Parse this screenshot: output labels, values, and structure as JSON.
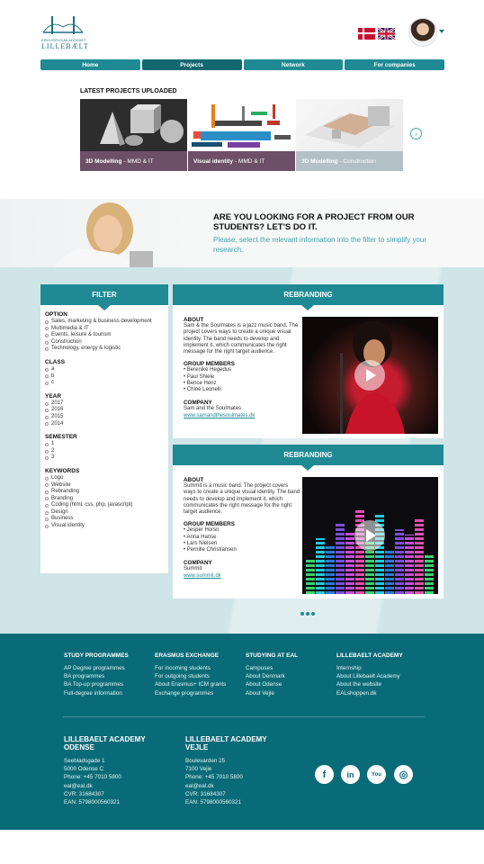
{
  "header": {
    "logo_line1": "ERHVERVSAKADEMIET",
    "logo_line2": "LILLEBÆLT"
  },
  "nav": {
    "items": [
      {
        "label": "Home"
      },
      {
        "label": "Projects"
      },
      {
        "label": "Network"
      },
      {
        "label": "For companies"
      }
    ],
    "active_index": 1
  },
  "latest": {
    "title": "LATEST PROJECTS UPLOADED",
    "cards": [
      {
        "category": "3D Modelling",
        "tag": "- MMD & IT"
      },
      {
        "category": "Visual identity",
        "tag": "- MMD & IT"
      },
      {
        "category": "3D Modelling",
        "tag": "- Construction"
      }
    ]
  },
  "hero": {
    "title": "ARE YOU LOOKING FOR A PROJECT FROM OUR STUDENTS? LET'S DO IT.",
    "subtitle": "Please, select the relevant information into the filter to simplify your research."
  },
  "filter": {
    "title": "FILTER",
    "groups": [
      {
        "title": "OPTION",
        "options": [
          "Sales, marketing & business development",
          "Multimedia & IT",
          "Events, leisure & tourism",
          "Construction",
          "Technology, energy & logistic"
        ]
      },
      {
        "title": "CLASS",
        "options": [
          "a",
          "b",
          "c"
        ]
      },
      {
        "title": "YEAR",
        "options": [
          "2017",
          "2016",
          "2015",
          "2014"
        ]
      },
      {
        "title": "SEMESTER",
        "options": [
          "1",
          "2",
          "3"
        ]
      },
      {
        "title": "KEYWORDS",
        "options": [
          "Logo",
          "Website",
          "Rebranding",
          "Branding",
          "Coding (html, css, php, javascript)",
          "Design",
          "Business",
          "Visual identity"
        ]
      }
    ]
  },
  "projects": [
    {
      "title": "REBRANDING",
      "about_label": "ABOUT",
      "about": "Sam & the Soulmates is a jazz music band. The project covers ways to create a unique visual identity. The band needs to develop and implement it, which communicates the right message for the right target audience.",
      "members_label": "GROUP MEMBERS",
      "members": [
        "Bereniké Hegedus",
        "Paul Shiele",
        "Bence Henz",
        "Chloé Leonelli"
      ],
      "company_label": "COMPANY",
      "company": "Sam and the Soulmates",
      "link": "www.samandthesoulmates.dk"
    },
    {
      "title": "REBRANDING",
      "about_label": "ABOUT",
      "about": "Summit is a music band. The project covers ways to create a unique visual identity. The band needs to develop and implement it, which communicates the right message for the right target audience.",
      "members_label": "GROUP MEMBERS",
      "members": [
        "Jesper Horsn",
        "Anna Hanse",
        "Lars Nielsen",
        "Pernille Christiansen"
      ],
      "company_label": "COMPANY",
      "company": "Summit",
      "link": "www.summit.dk"
    }
  ],
  "footer": {
    "columns": [
      {
        "title": "STUDY PROGRAMMES",
        "links": [
          "AP Degree programmes",
          "BA programmes",
          "BA Top-up programmes",
          "Full-degree information"
        ]
      },
      {
        "title": "ERASMUS EXCHANGE",
        "links": [
          "For incoming students",
          "For outgoing students",
          "About Erasmus+ ICM grants",
          "Exchange programmes"
        ]
      },
      {
        "title": "STUDYING AT EAL",
        "links": [
          "Campuses",
          "About Denmark",
          "About Odense",
          "About Vejle"
        ]
      },
      {
        "title": "LILLEBAELT ACADEMY",
        "links": [
          "Internship",
          "About Lillebaelt Academy",
          "About the website",
          "EALshoppen.dk"
        ]
      }
    ],
    "addresses": [
      {
        "title_1": "LILLEBAELT ACADEMY",
        "title_2": "ODENSE",
        "lines": [
          "Seebladsgade 1",
          "5000 Odense C",
          "Phone: +45 7010 5800",
          "eal@eal.dk",
          "CVR: 31684307",
          "EAN: 5798000560321"
        ]
      },
      {
        "title_1": "LILLEBAELT ACADEMY",
        "title_2": "VEJLE",
        "lines": [
          "Boulevarden 25",
          "7100 Vejle",
          "Phone: +45 7010 5800",
          "eal@eal.dk",
          "CVR: 31684307",
          "EAN: 5798000560321"
        ]
      }
    ],
    "social": [
      {
        "icon": "facebook-icon",
        "glyph": "f"
      },
      {
        "icon": "linkedin-icon",
        "glyph": "in"
      },
      {
        "icon": "youtube-icon",
        "glyph": "You"
      },
      {
        "icon": "instagram-icon",
        "glyph": "◎"
      }
    ]
  },
  "colors": {
    "primary": "#1f8a94",
    "primary_dark": "#136870",
    "footer": "#0a6b78",
    "caption": "#6d5067",
    "accent_text": "#3fa7b0"
  }
}
